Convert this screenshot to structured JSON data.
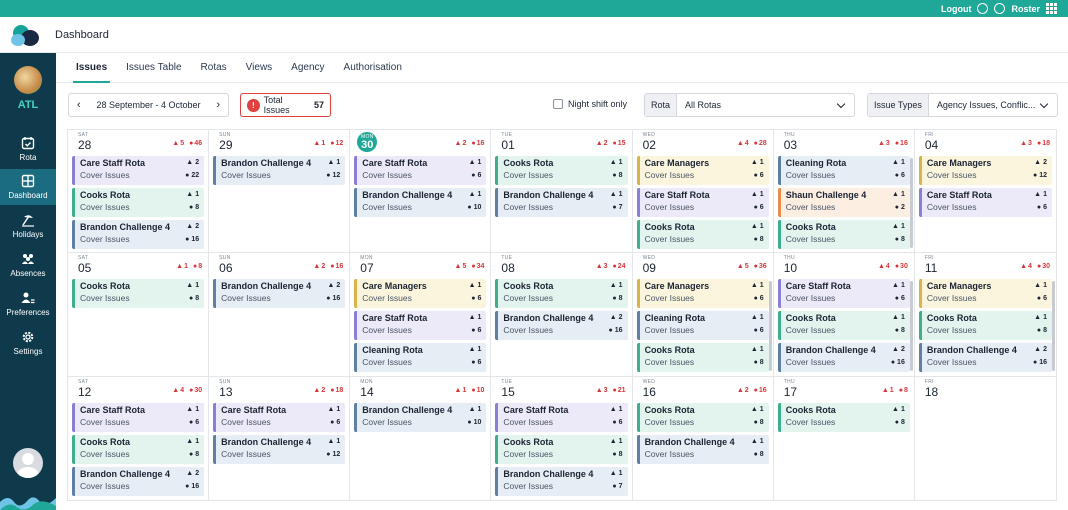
{
  "topbar": {
    "logout": "Logout",
    "roster": "Roster"
  },
  "header": {
    "title": "Dashboard"
  },
  "sidebar": {
    "code": "ATL",
    "items": [
      {
        "label": "Rota",
        "icon": "calendar-check-icon"
      },
      {
        "label": "Dashboard",
        "icon": "dashboard-icon"
      },
      {
        "label": "Holidays",
        "icon": "holiday-icon"
      },
      {
        "label": "Absences",
        "icon": "absences-icon"
      },
      {
        "label": "Preferences",
        "icon": "preferences-icon"
      },
      {
        "label": "Settings",
        "icon": "gear-icon"
      }
    ]
  },
  "tabs": [
    "Issues",
    "Issues Table",
    "Rotas",
    "Views",
    "Agency",
    "Authorisation"
  ],
  "toolbar": {
    "date_range": "28 September - 4 October",
    "total_label": "Total Issues",
    "total_value": "57",
    "night_label": "Night shift only",
    "rota_label": "Rota",
    "rota_value": "All Rotas",
    "issue_label": "Issue Types",
    "issue_value": "Agency Issues, Conflic..."
  },
  "colors": {
    "accent": "#1fa898",
    "danger": "#e0413f",
    "sidebar": "#0f3a4c"
  },
  "calendar": {
    "days": [
      {
        "dn": "SAT",
        "num": "28",
        "w": "5",
        "e": "46",
        "cards": [
          {
            "t": "Care Staff Rota",
            "s": "Cover Issues",
            "a": "2",
            "b": "22",
            "c": "purple"
          },
          {
            "t": "Cooks Rota",
            "s": "Cover Issues",
            "a": "1",
            "b": "8",
            "c": "green"
          },
          {
            "t": "Brandon Challenge 4",
            "s": "Cover Issues",
            "a": "2",
            "b": "16",
            "c": "blue"
          }
        ]
      },
      {
        "dn": "SUN",
        "num": "29",
        "w": "1",
        "e": "12",
        "cards": [
          {
            "t": "Brandon Challenge 4",
            "s": "Cover Issues",
            "a": "1",
            "b": "12",
            "c": "blue"
          }
        ]
      },
      {
        "dn": "MON",
        "num": "30",
        "w": "2",
        "e": "16",
        "today": true,
        "cards": [
          {
            "t": "Care Staff Rota",
            "s": "Cover Issues",
            "a": "1",
            "b": "6",
            "c": "purple"
          },
          {
            "t": "Brandon Challenge 4",
            "s": "Cover Issues",
            "a": "1",
            "b": "10",
            "c": "blue"
          }
        ]
      },
      {
        "dn": "TUE",
        "num": "01",
        "w": "2",
        "e": "15",
        "cards": [
          {
            "t": "Cooks Rota",
            "s": "Cover Issues",
            "a": "1",
            "b": "8",
            "c": "green"
          },
          {
            "t": "Brandon Challenge 4",
            "s": "Cover Issues",
            "a": "1",
            "b": "7",
            "c": "blue"
          }
        ]
      },
      {
        "dn": "WED",
        "num": "02",
        "w": "4",
        "e": "28",
        "cards": [
          {
            "t": "Care Managers",
            "s": "Cover Issues",
            "a": "1",
            "b": "6",
            "c": "yellow"
          },
          {
            "t": "Care Staff Rota",
            "s": "Cover Issues",
            "a": "1",
            "b": "6",
            "c": "purple"
          },
          {
            "t": "Cooks Rota",
            "s": "Cover Issues",
            "a": "1",
            "b": "8",
            "c": "green"
          }
        ]
      },
      {
        "dn": "THU",
        "num": "03",
        "w": "3",
        "e": "16",
        "cards": [
          {
            "t": "Cleaning Rota",
            "s": "Cover Issues",
            "a": "1",
            "b": "6",
            "c": "blue"
          },
          {
            "t": "Shaun Challenge 4",
            "s": "Cover Issues",
            "a": "1",
            "b": "2",
            "c": "orange"
          },
          {
            "t": "Cooks Rota",
            "s": "Cover Issues",
            "a": "1",
            "b": "8",
            "c": "green"
          }
        ],
        "scroll": true
      },
      {
        "dn": "FRI",
        "num": "04",
        "w": "3",
        "e": "18",
        "cards": [
          {
            "t": "Care Managers",
            "s": "Cover Issues",
            "a": "2",
            "b": "12",
            "c": "yellow"
          },
          {
            "t": "Care Staff Rota",
            "s": "Cover Issues",
            "a": "1",
            "b": "6",
            "c": "purple"
          }
        ]
      },
      {
        "dn": "SAT",
        "num": "05",
        "w": "1",
        "e": "8",
        "cards": [
          {
            "t": "Cooks Rota",
            "s": "Cover Issues",
            "a": "1",
            "b": "8",
            "c": "green"
          }
        ]
      },
      {
        "dn": "SUN",
        "num": "06",
        "w": "2",
        "e": "16",
        "cards": [
          {
            "t": "Brandon Challenge 4",
            "s": "Cover Issues",
            "a": "2",
            "b": "16",
            "c": "blue"
          }
        ]
      },
      {
        "dn": "MON",
        "num": "07",
        "w": "5",
        "e": "34",
        "cards": [
          {
            "t": "Care Managers",
            "s": "Cover Issues",
            "a": "1",
            "b": "6",
            "c": "yellow"
          },
          {
            "t": "Care Staff Rota",
            "s": "Cover Issues",
            "a": "1",
            "b": "6",
            "c": "purple"
          },
          {
            "t": "Cleaning Rota",
            "s": "Cover Issues",
            "a": "1",
            "b": "6",
            "c": "blue"
          }
        ]
      },
      {
        "dn": "TUE",
        "num": "08",
        "w": "3",
        "e": "24",
        "cards": [
          {
            "t": "Cooks Rota",
            "s": "Cover Issues",
            "a": "1",
            "b": "8",
            "c": "green"
          },
          {
            "t": "Brandon Challenge 4",
            "s": "Cover Issues",
            "a": "2",
            "b": "16",
            "c": "blue"
          }
        ]
      },
      {
        "dn": "WED",
        "num": "09",
        "w": "5",
        "e": "36",
        "cards": [
          {
            "t": "Care Managers",
            "s": "Cover Issues",
            "a": "1",
            "b": "6",
            "c": "yellow"
          },
          {
            "t": "Cleaning Rota",
            "s": "Cover Issues",
            "a": "1",
            "b": "6",
            "c": "blue"
          },
          {
            "t": "Cooks Rota",
            "s": "Cover Issues",
            "a": "1",
            "b": "8",
            "c": "green"
          }
        ],
        "scroll": true
      },
      {
        "dn": "THU",
        "num": "10",
        "w": "4",
        "e": "30",
        "cards": [
          {
            "t": "Care Staff Rota",
            "s": "Cover Issues",
            "a": "1",
            "b": "6",
            "c": "purple"
          },
          {
            "t": "Cooks Rota",
            "s": "Cover Issues",
            "a": "1",
            "b": "8",
            "c": "green"
          },
          {
            "t": "Brandon Challenge 4",
            "s": "Cover Issues",
            "a": "2",
            "b": "16",
            "c": "blue"
          }
        ],
        "scroll": true
      },
      {
        "dn": "FRI",
        "num": "11",
        "w": "4",
        "e": "30",
        "cards": [
          {
            "t": "Care Managers",
            "s": "Cover Issues",
            "a": "1",
            "b": "6",
            "c": "yellow"
          },
          {
            "t": "Cooks Rota",
            "s": "Cover Issues",
            "a": "1",
            "b": "8",
            "c": "green"
          },
          {
            "t": "Brandon Challenge 4",
            "s": "Cover Issues",
            "a": "2",
            "b": "16",
            "c": "blue"
          }
        ],
        "scroll": true
      },
      {
        "dn": "SAT",
        "num": "12",
        "w": "4",
        "e": "30",
        "cards": [
          {
            "t": "Care Staff Rota",
            "s": "Cover Issues",
            "a": "1",
            "b": "6",
            "c": "purple"
          },
          {
            "t": "Cooks Rota",
            "s": "Cover Issues",
            "a": "1",
            "b": "8",
            "c": "green"
          },
          {
            "t": "Brandon Challenge 4",
            "s": "Cover Issues",
            "a": "2",
            "b": "16",
            "c": "blue"
          }
        ]
      },
      {
        "dn": "SUN",
        "num": "13",
        "w": "2",
        "e": "18",
        "cards": [
          {
            "t": "Care Staff Rota",
            "s": "Cover Issues",
            "a": "1",
            "b": "6",
            "c": "purple"
          },
          {
            "t": "Brandon Challenge 4",
            "s": "Cover Issues",
            "a": "1",
            "b": "12",
            "c": "blue"
          }
        ]
      },
      {
        "dn": "MON",
        "num": "14",
        "w": "1",
        "e": "10",
        "cards": [
          {
            "t": "Brandon Challenge 4",
            "s": "Cover Issues",
            "a": "1",
            "b": "10",
            "c": "blue"
          }
        ]
      },
      {
        "dn": "TUE",
        "num": "15",
        "w": "3",
        "e": "21",
        "cards": [
          {
            "t": "Care Staff Rota",
            "s": "Cover Issues",
            "a": "1",
            "b": "6",
            "c": "purple"
          },
          {
            "t": "Cooks Rota",
            "s": "Cover Issues",
            "a": "1",
            "b": "8",
            "c": "green"
          },
          {
            "t": "Brandon Challenge 4",
            "s": "Cover Issues",
            "a": "1",
            "b": "7",
            "c": "blue"
          }
        ]
      },
      {
        "dn": "WED",
        "num": "16",
        "w": "2",
        "e": "16",
        "cards": [
          {
            "t": "Cooks Rota",
            "s": "Cover Issues",
            "a": "1",
            "b": "8",
            "c": "green"
          },
          {
            "t": "Brandon Challenge 4",
            "s": "Cover Issues",
            "a": "1",
            "b": "8",
            "c": "blue"
          }
        ]
      },
      {
        "dn": "THU",
        "num": "17",
        "w": "1",
        "e": "8",
        "cards": [
          {
            "t": "Cooks Rota",
            "s": "Cover Issues",
            "a": "1",
            "b": "8",
            "c": "green"
          }
        ]
      },
      {
        "dn": "FRI",
        "num": "18",
        "w": "",
        "e": "",
        "cards": []
      }
    ]
  }
}
